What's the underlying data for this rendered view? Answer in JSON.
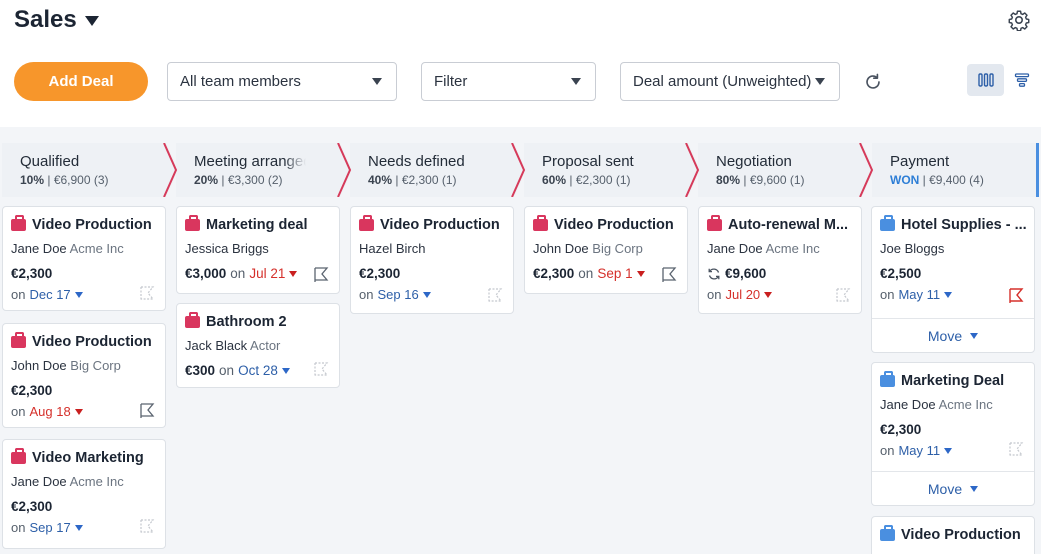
{
  "header": {
    "title": "Sales",
    "add_deal_label": "Add Deal",
    "team_select": "All team members",
    "filter_select": "Filter",
    "amount_select": "Deal amount (Unweighted)"
  },
  "stages": [
    {
      "name": "Qualified",
      "pct": "10%",
      "summary": "€6,900 (3)"
    },
    {
      "name": "Meeting arranged",
      "pct": "20%",
      "summary": "€3,300 (2)"
    },
    {
      "name": "Needs defined",
      "pct": "40%",
      "summary": "€2,300 (1)"
    },
    {
      "name": "Proposal sent",
      "pct": "60%",
      "summary": "€2,300 (1)"
    },
    {
      "name": "Negotiation",
      "pct": "80%",
      "summary": "€9,600 (1)"
    },
    {
      "name": "Payment",
      "pct": "WON",
      "summary": "€9,400 (4)"
    }
  ],
  "colors": {
    "accent": "#f7962b",
    "deal_open": "#d9365e",
    "deal_won": "#4a8fe0"
  },
  "deals": {
    "c0": [
      {
        "title": "Video Production",
        "person": "Jane Doe",
        "org": "Acme Inc",
        "amount": "€2,300",
        "on": "on",
        "date": "Dec 17"
      },
      {
        "title": "Video Production",
        "person": "John Doe",
        "org": "Big Corp",
        "amount": "€2,300",
        "on": "on",
        "date": "Aug 18"
      },
      {
        "title": "Video Marketing",
        "person": "Jane Doe",
        "org": "Acme Inc",
        "amount": "€2,300",
        "on": "on",
        "date": "Sep 17"
      }
    ],
    "c1": [
      {
        "title": "Marketing deal",
        "person": "Jessica Briggs",
        "org": "",
        "amount": "€3,000",
        "on": "on",
        "date": "Jul 21"
      },
      {
        "title": "Bathroom 2",
        "person": "Jack Black",
        "org": "Actor",
        "amount": "€300",
        "on": "on",
        "date": "Oct 28"
      }
    ],
    "c2": [
      {
        "title": "Video Production",
        "person": "Hazel Birch",
        "org": "",
        "amount": "€2,300",
        "on": "on",
        "date": "Sep 16"
      }
    ],
    "c3": [
      {
        "title": "Video Production",
        "person": "John Doe",
        "org": "Big Corp",
        "amount": "€2,300",
        "on": "on",
        "date": "Sep 1"
      }
    ],
    "c4": [
      {
        "title": "Auto-renewal M...",
        "person": "Jane Doe",
        "org": "Acme Inc",
        "amount": "€9,600",
        "on": "on",
        "date": "Jul 20"
      }
    ],
    "c5": [
      {
        "title": "Hotel Supplies - ...",
        "person": "Joe Bloggs",
        "org": "",
        "amount": "€2,500",
        "on": "on",
        "date": "May 11",
        "move": "Move"
      },
      {
        "title": "Marketing Deal",
        "person": "Jane Doe",
        "org": "Acme Inc",
        "amount": "€2,300",
        "on": "on",
        "date": "May 11",
        "move": "Move"
      },
      {
        "title": "Video Production"
      }
    ]
  }
}
